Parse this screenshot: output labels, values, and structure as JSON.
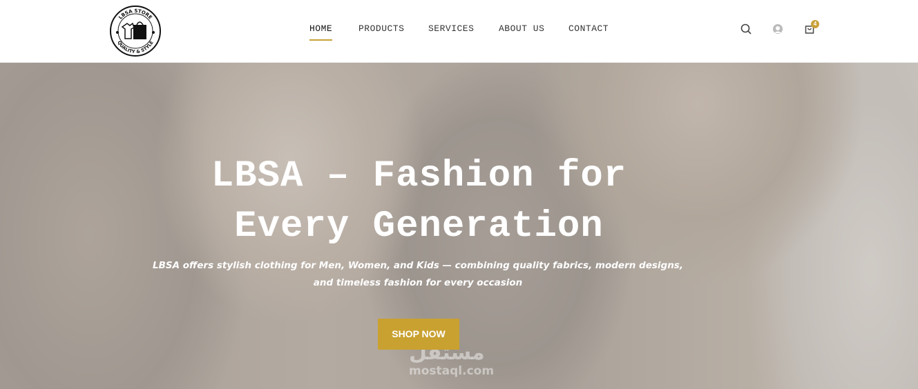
{
  "header": {
    "logo": {
      "top_text": "LBSA STORE",
      "bottom_text": "QUALITY & STYLE"
    },
    "nav": [
      {
        "label": "HOME",
        "active": true
      },
      {
        "label": "PRODUCTS",
        "active": false
      },
      {
        "label": "SERVICES",
        "active": false
      },
      {
        "label": "ABOUT US",
        "active": false
      },
      {
        "label": "CONTACT",
        "active": false
      }
    ],
    "icons": [
      "search-icon",
      "user-icon",
      "cart-icon"
    ],
    "cart_count": "4",
    "accent_color": "#c9a13a"
  },
  "hero": {
    "title_line1": "LBSA – Fashion for",
    "title_line2": "Every Generation",
    "subtitle": "LBSA offers stylish clothing for Men, Women, and Kids — combining quality fabrics, modern designs, and timeless fashion for every occasion",
    "cta_label": "SHOP NOW",
    "cta_color": "#c9a130"
  },
  "watermark": {
    "arabic": "مستقل",
    "url": "mostaql.com"
  }
}
